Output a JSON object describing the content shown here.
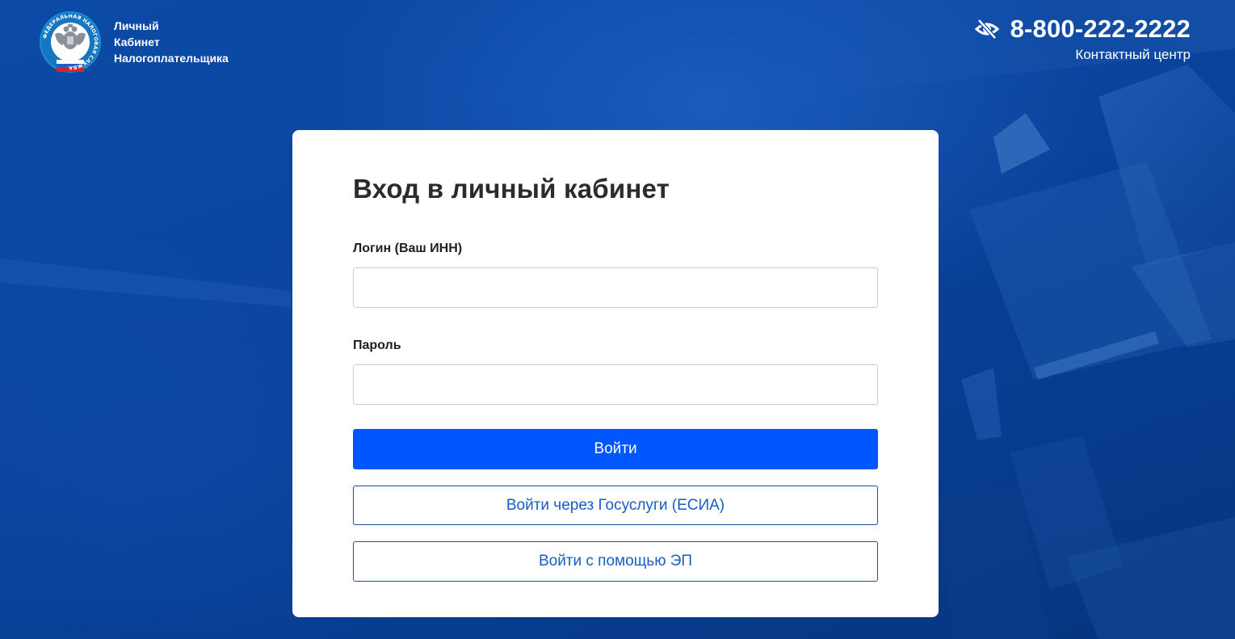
{
  "header": {
    "brand_lines": [
      "Личный",
      "Кабинет",
      "Налогоплательщика"
    ],
    "logo_ring_text": "ФЕДЕРАЛЬНАЯ НАЛОГОВАЯ СЛУЖБА",
    "phone": "8-800-222-2222",
    "contact_label": "Контактный центр"
  },
  "icons": {
    "accessibility": "eye-slash-icon"
  },
  "login_card": {
    "title": "Вход в личный кабинет",
    "login_label": "Логин (Ваш ИНН)",
    "login_value": "",
    "password_label": "Пароль",
    "password_value": "",
    "submit_label": "Войти",
    "esia_label": "Войти через Госуслуги (ЕСИА)",
    "ep_label": "Войти с помощью ЭП"
  },
  "colors": {
    "background": "#0a47a3",
    "primary_button": "#0056ff",
    "outline_text": "#1a5cc8",
    "card": "#ffffff"
  }
}
